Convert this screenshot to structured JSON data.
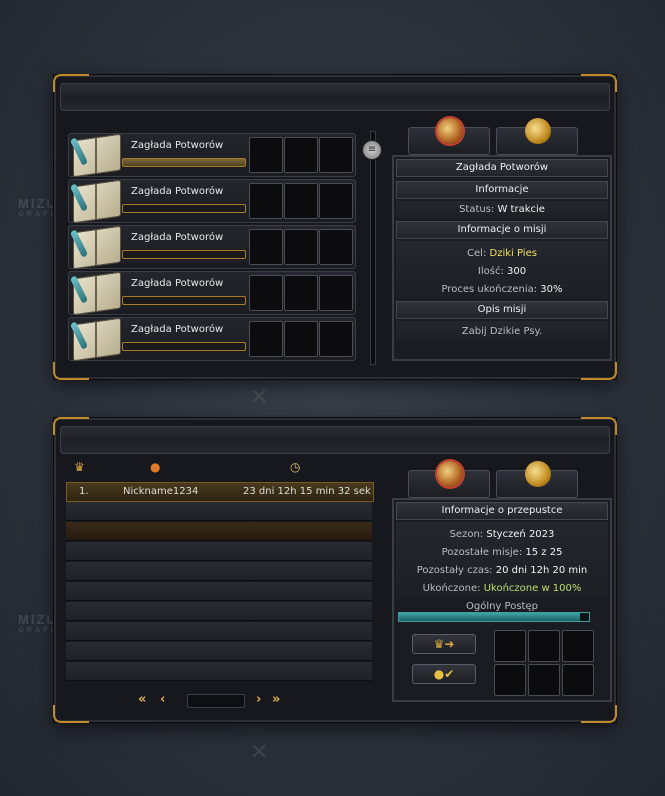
{
  "watermark": {
    "brand": "MIZUNE",
    "sub": "GRAPHICS"
  },
  "missions_window": {
    "missions": [
      {
        "name": "Zagłada Potworów",
        "progress": 1.0
      },
      {
        "name": "Zagłada Potworów",
        "progress": 0.0
      },
      {
        "name": "Zagłada Potworów",
        "progress": 0.0
      },
      {
        "name": "Zagłada Potworów",
        "progress": 0.0
      },
      {
        "name": "Zagłada Potworów",
        "progress": 0.0
      }
    ],
    "detail": {
      "title": "Zagłada Potworów",
      "info_header": "Informacje",
      "status_label": "Status:",
      "status_value": "W trakcie",
      "mission_info_header": "Informacje o misji",
      "target_label": "Cel:",
      "target_value": "Dziki Pies",
      "amount_label": "Ilość:",
      "amount_value": "300",
      "completion_label": "Proces ukończenia:",
      "completion_value": "30%",
      "description_header": "Opis misji",
      "description": "Zabij Dzikie Psy."
    }
  },
  "pass_window": {
    "ranking": [
      {
        "rank": "1.",
        "nickname": "Nickname1234",
        "time": "23 dni 12h 15 min 32 sek"
      }
    ],
    "info": {
      "header": "Informacje o przepustce",
      "season_label": "Sezon:",
      "season_value": "Styczeń 2023",
      "missions_left_label": "Pozostałe misje:",
      "missions_left_value": "15 z 25",
      "time_left_label": "Pozostały czas:",
      "time_left_value": "20 dni 12h 20 min",
      "completed_label": "Ukończone:",
      "completed_value": "Ukończone w 100%",
      "overall_progress_label": "Ogólny Postęp",
      "overall_progress": 0.95
    },
    "pager": {
      "first": "«",
      "prev": "‹",
      "next": "›",
      "last": "»"
    }
  },
  "colors": {
    "gold": "#c08a2a",
    "teal_progress": "#3fa6a8",
    "yellow_text": "#f0e060"
  }
}
